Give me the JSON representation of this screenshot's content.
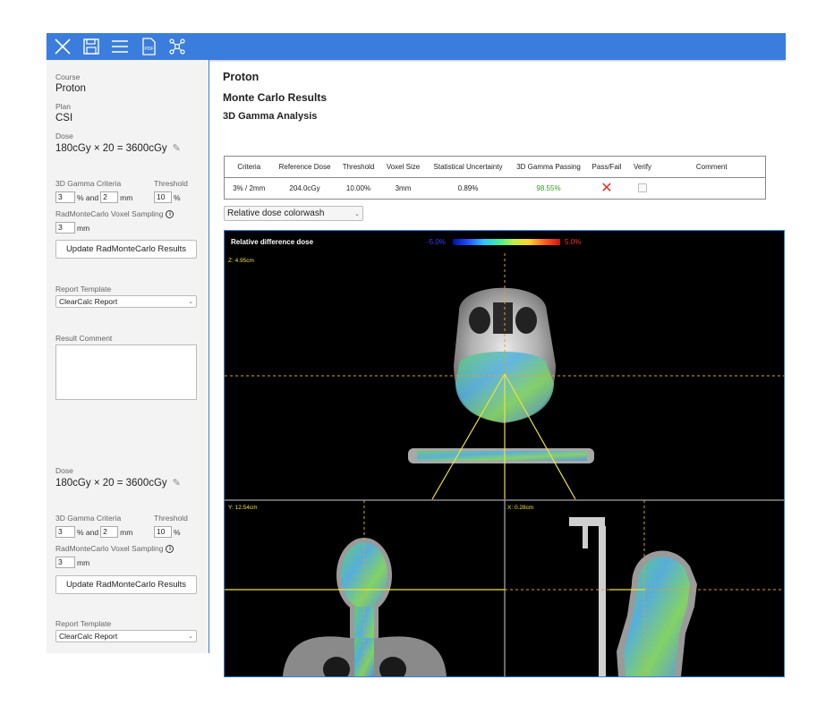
{
  "toolbar": {
    "icons": [
      "close-icon",
      "save-icon",
      "menu-icon",
      "pdf-icon",
      "molecule-icon"
    ],
    "pdf_label": "PDF"
  },
  "sidebar": {
    "course_label": "Course",
    "course_value": "Proton",
    "plan_label": "Plan",
    "plan_value": "CSI",
    "sections": [
      {
        "dose_label": "Dose",
        "dose_value": "180cGy × 20 = 3600cGy",
        "gamma_label": "3D Gamma Criteria",
        "threshold_label": "Threshold",
        "gamma_pct": "3",
        "pct_and": "% and",
        "gamma_mm": "2",
        "mm_unit": "mm",
        "threshold_value": "10",
        "threshold_unit": "%",
        "sampling_label": "RadMonteCarlo Voxel Sampling",
        "sampling_value": "3",
        "sampling_unit": "mm",
        "update_button": "Update RadMonteCarlo Results",
        "report_template_label": "Report Template",
        "report_template_value": "ClearCalc Report"
      },
      {
        "dose_label": "Dose",
        "dose_value": "180cGy × 20 = 3600cGy",
        "gamma_label": "3D Gamma Criteria",
        "threshold_label": "Threshold",
        "gamma_pct": "3",
        "pct_and": "% and",
        "gamma_mm": "2",
        "mm_unit": "mm",
        "threshold_value": "10",
        "threshold_unit": "%",
        "sampling_label": "RadMonteCarlo Voxel Sampling",
        "sampling_value": "3",
        "sampling_unit": "mm",
        "update_button": "Update RadMonteCarlo Results",
        "report_template_label": "Report Template",
        "report_template_value": "ClearCalc Report"
      }
    ],
    "result_comment_label": "Result Comment"
  },
  "main": {
    "title": "Proton",
    "subtitle": "Monte Carlo Results",
    "section_title": "3D Gamma Analysis",
    "table": {
      "headers": [
        "Criteria",
        "Reference Dose",
        "Threshold",
        "Voxel Size",
        "Statistical Uncertainty",
        "3D Gamma Passing",
        "Pass/Fail",
        "Verify",
        "Comment"
      ],
      "row": {
        "criteria": "3% / 2mm",
        "reference_dose": "204.0cGy",
        "threshold": "10.00%",
        "voxel_size": "3mm",
        "uncertainty": "0.89%",
        "gamma_passing": "98.55%",
        "pass_fail": "fail-x-icon",
        "verify": false,
        "comment": ""
      }
    },
    "colorwash_select": "Relative dose colorwash",
    "viewer": {
      "title": "Relative difference dose",
      "scale_min": "-5.0%",
      "scale_max": "5.0%",
      "axial_label": "Z: 4.95cm",
      "coronal_label": "Y: 12.54cm",
      "sagittal_label": "X: 0.28cm",
      "colors": {
        "min": "#3030ff",
        "max": "#ff3020",
        "crosshair": "#e0a030",
        "beam": "#f0e040"
      }
    }
  }
}
